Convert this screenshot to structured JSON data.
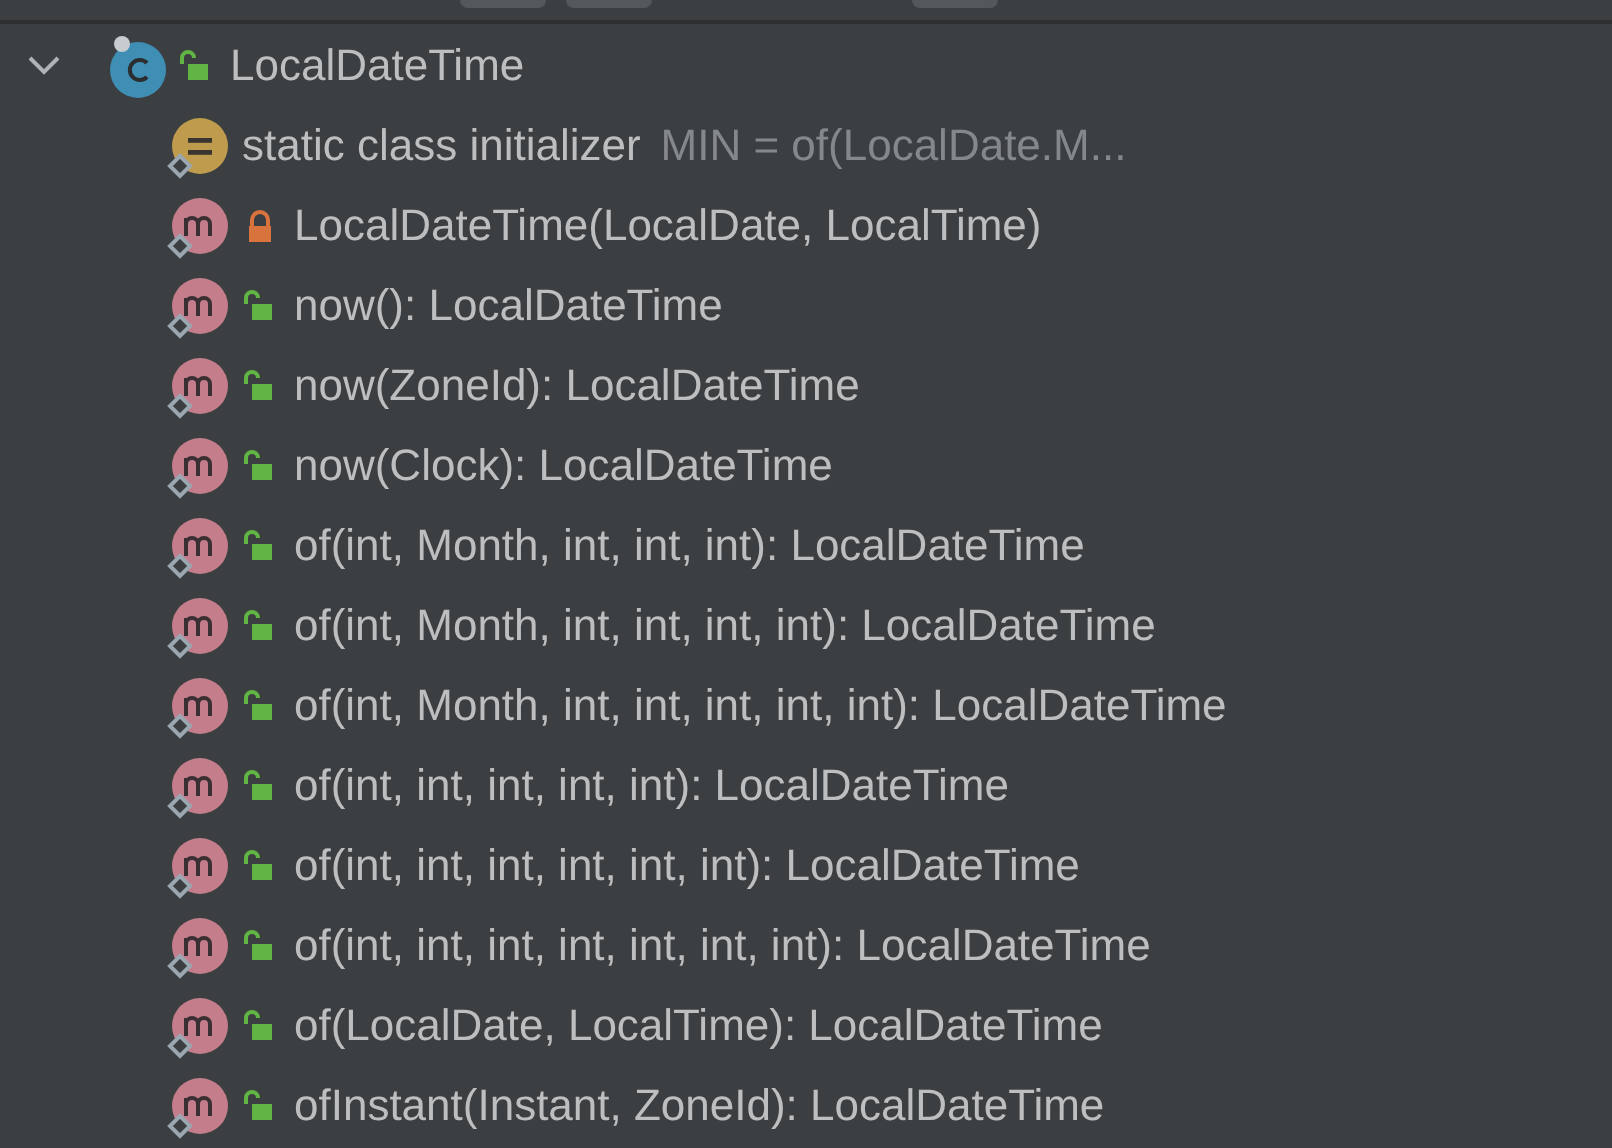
{
  "toolbar": {
    "buttons": [
      {
        "kind": "button"
      },
      {
        "kind": "button"
      },
      {
        "kind": "button"
      }
    ]
  },
  "tree": {
    "name": "LocalDateTime",
    "kind": "class",
    "private": false,
    "expanded": true,
    "children": [
      {
        "kind": "initializer",
        "text": "static class initializer",
        "detail": "MIN = of(LocalDate.M..."
      },
      {
        "kind": "method",
        "private": true,
        "text": "LocalDateTime(LocalDate, LocalTime)"
      },
      {
        "kind": "method",
        "private": false,
        "text": "now(): LocalDateTime"
      },
      {
        "kind": "method",
        "private": false,
        "text": "now(ZoneId): LocalDateTime"
      },
      {
        "kind": "method",
        "private": false,
        "text": "now(Clock): LocalDateTime"
      },
      {
        "kind": "method",
        "private": false,
        "text": "of(int, Month, int, int, int): LocalDateTime"
      },
      {
        "kind": "method",
        "private": false,
        "text": "of(int, Month, int, int, int, int): LocalDateTime"
      },
      {
        "kind": "method",
        "private": false,
        "text": "of(int, Month, int, int, int, int, int): LocalDateTime"
      },
      {
        "kind": "method",
        "private": false,
        "text": "of(int, int, int, int, int): LocalDateTime"
      },
      {
        "kind": "method",
        "private": false,
        "text": "of(int, int, int, int, int, int): LocalDateTime"
      },
      {
        "kind": "method",
        "private": false,
        "text": "of(int, int, int, int, int, int, int): LocalDateTime"
      },
      {
        "kind": "method",
        "private": false,
        "text": "of(LocalDate, LocalTime): LocalDateTime"
      },
      {
        "kind": "method",
        "private": false,
        "text": "ofInstant(Instant, ZoneId): LocalDateTime"
      }
    ]
  }
}
